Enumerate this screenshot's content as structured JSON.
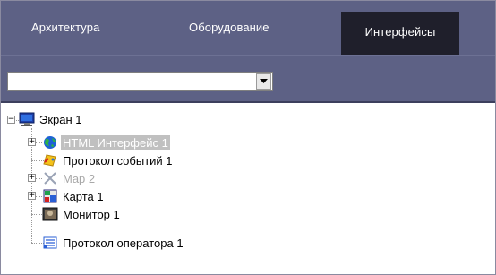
{
  "tabs": [
    {
      "label": "Архитектура",
      "active": false
    },
    {
      "label": "Оборудование",
      "active": false
    },
    {
      "label": "Интерфейсы",
      "active": true
    }
  ],
  "toolbar": {
    "combo_value": ""
  },
  "tree": {
    "root": {
      "label": "Экран 1",
      "icon": "monitor-icon",
      "expanded": true
    },
    "children": [
      {
        "label": "HTML Интерфейс 1",
        "icon": "globe-icon",
        "expandable": true,
        "selected": true
      },
      {
        "label": "Протокол событий 1",
        "icon": "event-log-icon",
        "expandable": false
      },
      {
        "label": "Map 2",
        "icon": "map-x-icon",
        "expandable": true,
        "disabled": true
      },
      {
        "label": "Карта 1",
        "icon": "map-icon",
        "expandable": true
      },
      {
        "label": "Монитор 1",
        "icon": "video-monitor-icon",
        "expandable": false
      },
      {
        "label": "Протокол оператора 1",
        "icon": "operator-log-icon",
        "expandable": false
      }
    ]
  },
  "colors": {
    "tabbar": "#5d6185",
    "active_tab": "#1f1f2b",
    "selection": "#c0c0c0"
  }
}
